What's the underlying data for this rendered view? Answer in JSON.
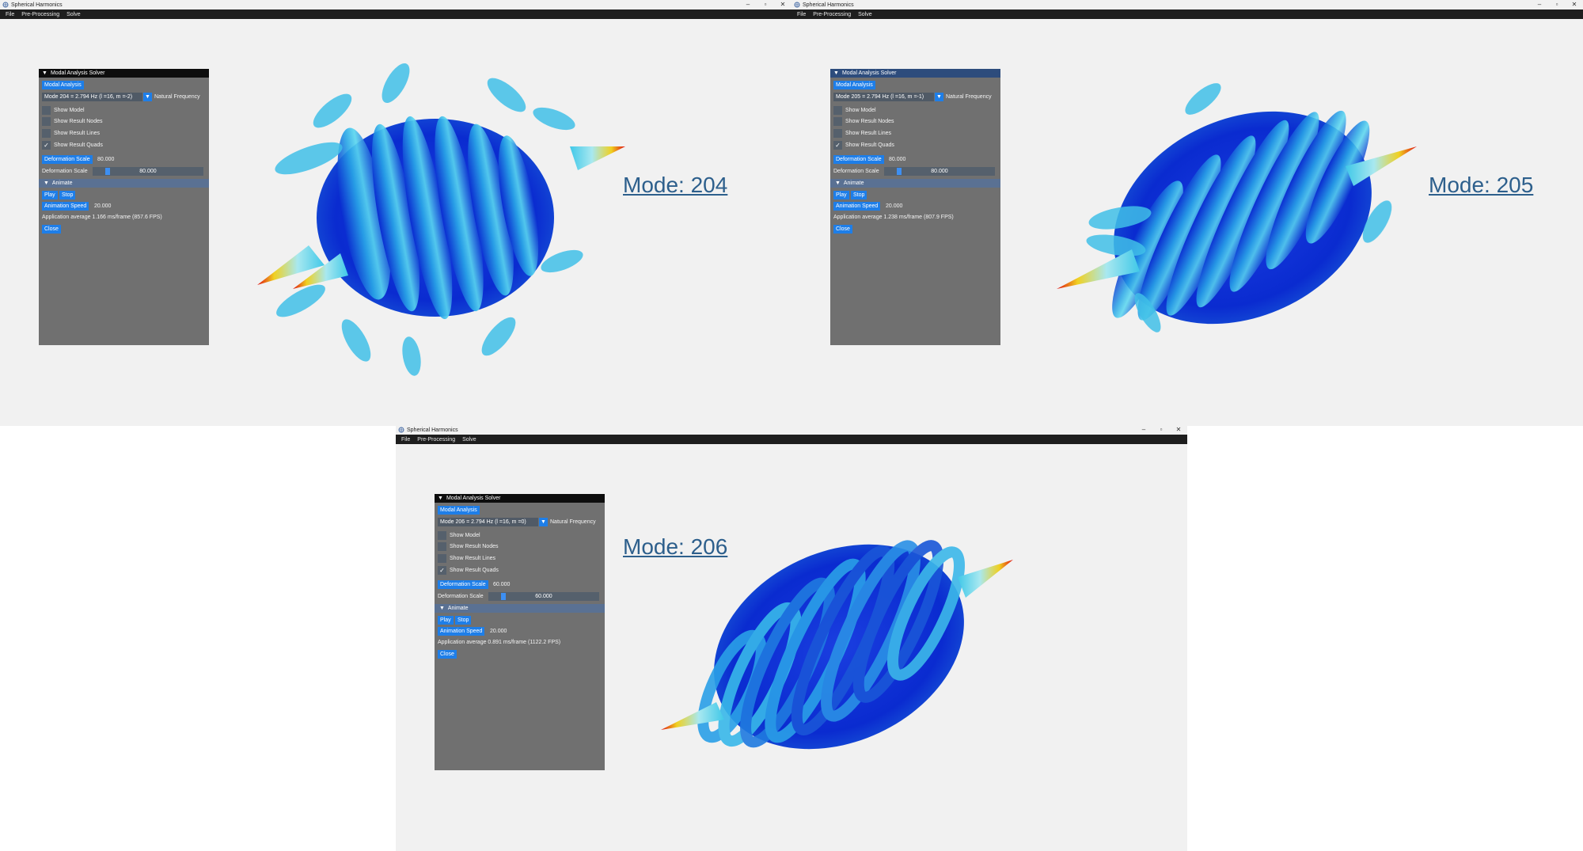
{
  "windows": [
    {
      "title": "Spherical Harmonics",
      "menu": [
        "File",
        "Pre-Processing",
        "Solve"
      ],
      "panel": {
        "header": "Modal Analysis Solver",
        "modal_analysis_label": "Modal Analysis",
        "mode_select": "Mode 204 = 2.794 Hz (l =16, m =-2)",
        "natural_frequency_label": "Natural Frequency",
        "checkboxes": [
          {
            "label": "Show Model",
            "checked": false
          },
          {
            "label": "Show Result Nodes",
            "checked": false
          },
          {
            "label": "Show Result Lines",
            "checked": false
          },
          {
            "label": "Show Result Quads",
            "checked": true
          }
        ],
        "deformation_scale_button": "Deformation Scale",
        "deformation_scale_value": "80.000",
        "deformation_scale_label": "Deformation Scale",
        "deformation_slider_value": "80.000",
        "animate_label": "Animate",
        "play_label": "Play",
        "stop_label": "Stop",
        "animation_speed_button": "Animation Speed",
        "animation_speed_value": "20.000",
        "app_average": "Application average 1.166 ms/frame (857.6 FPS)",
        "close_label": "Close"
      },
      "mode_label": "Mode: 204"
    },
    {
      "title": "Spherical Harmonics",
      "menu": [
        "File",
        "Pre-Processing",
        "Solve"
      ],
      "panel": {
        "header": "Modal Analysis Solver",
        "modal_analysis_label": "Modal Analysis",
        "mode_select": "Mode 205 = 2.794 Hz (l =16, m =-1)",
        "natural_frequency_label": "Natural Frequency",
        "checkboxes": [
          {
            "label": "Show Model",
            "checked": false
          },
          {
            "label": "Show Result Nodes",
            "checked": false
          },
          {
            "label": "Show Result Lines",
            "checked": false
          },
          {
            "label": "Show Result Quads",
            "checked": true
          }
        ],
        "deformation_scale_button": "Deformation Scale",
        "deformation_scale_value": "80.000",
        "deformation_scale_label": "Deformation Scale",
        "deformation_slider_value": "80.000",
        "animate_label": "Animate",
        "play_label": "Play",
        "stop_label": "Stop",
        "animation_speed_button": "Animation Speed",
        "animation_speed_value": "20.000",
        "app_average": "Application average 1.238 ms/frame (807.9 FPS)",
        "close_label": "Close"
      },
      "mode_label": "Mode: 205"
    },
    {
      "title": "Spherical Harmonics",
      "menu": [
        "File",
        "Pre-Processing",
        "Solve"
      ],
      "panel": {
        "header": "Modal Analysis Solver",
        "modal_analysis_label": "Modal Analysis",
        "mode_select": "Mode 206 = 2.794 Hz (l =16, m =0)",
        "natural_frequency_label": "Natural Frequency",
        "checkboxes": [
          {
            "label": "Show Model",
            "checked": false
          },
          {
            "label": "Show Result Nodes",
            "checked": false
          },
          {
            "label": "Show Result Lines",
            "checked": false
          },
          {
            "label": "Show Result Quads",
            "checked": true
          }
        ],
        "deformation_scale_button": "Deformation Scale",
        "deformation_scale_value": "60.000",
        "deformation_scale_label": "Deformation Scale",
        "deformation_slider_value": "60.000",
        "animate_label": "Animate",
        "play_label": "Play",
        "stop_label": "Stop",
        "animation_speed_button": "Animation Speed",
        "animation_speed_value": "20.000",
        "app_average": "Application average 0.891 ms/frame (1122.2 FPS)",
        "close_label": "Close"
      },
      "mode_label": "Mode: 206"
    }
  ],
  "window_controls": [
    "–",
    "▫",
    "✕"
  ],
  "colors": {
    "background": "#f1f1f1",
    "menubar": "#1e1e1e",
    "panel": "#707070",
    "accent": "#1e7ee8",
    "deep_blue": "#0a2fd0",
    "cyan": "#30c8e8",
    "tip_red": "#e01010",
    "tip_yellow": "#f0d020",
    "mode_label": "#2d5f8c"
  }
}
